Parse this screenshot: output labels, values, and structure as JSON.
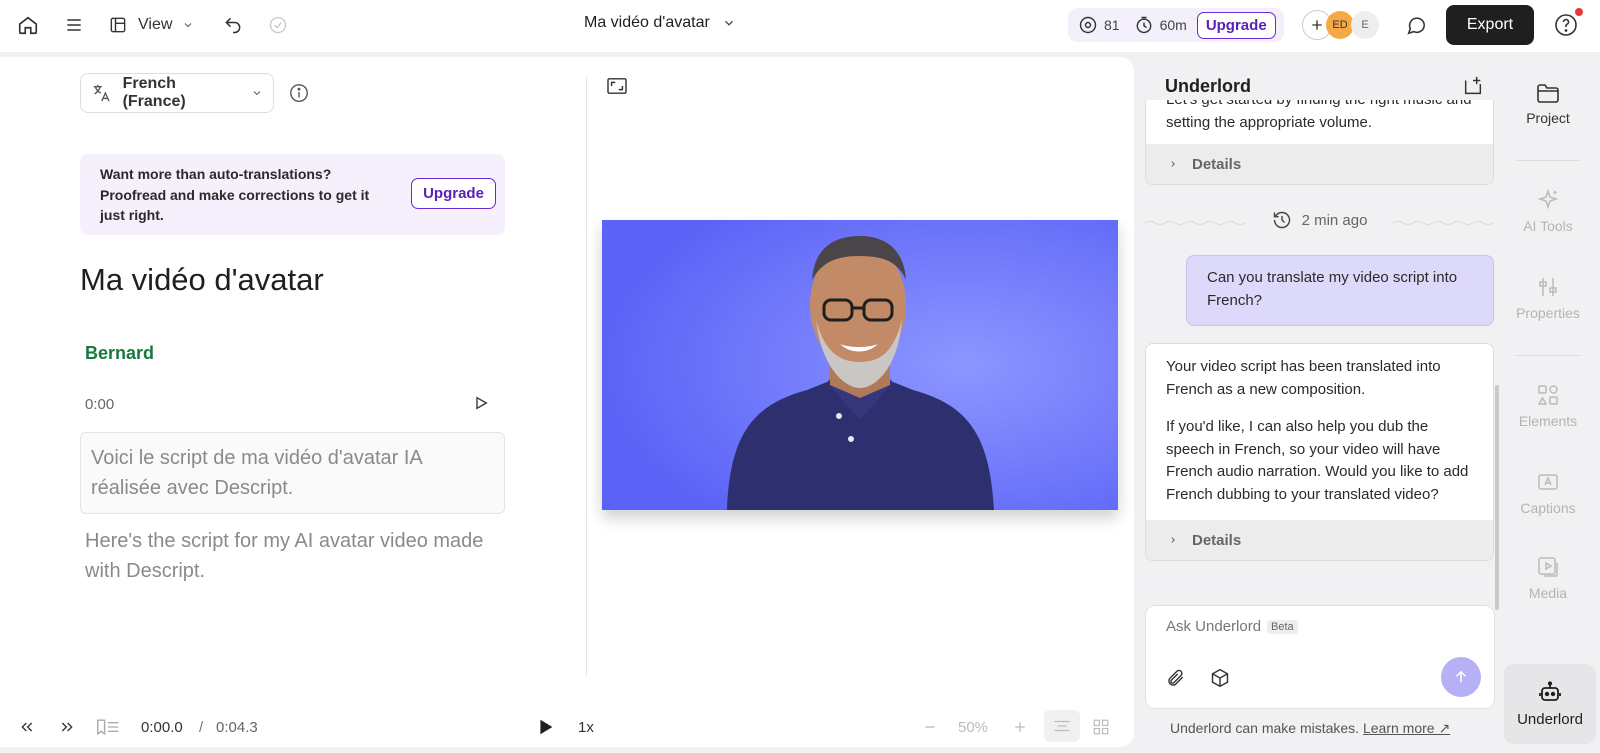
{
  "topbar": {
    "view_label": "View",
    "project_title": "Ma vidéo d'avatar",
    "media_count": "81",
    "time_remaining": "60m",
    "upgrade_label": "Upgrade",
    "avatar_1": "ED",
    "avatar_2": "E",
    "export_label": "Export"
  },
  "editor": {
    "language": "French (France)",
    "banner_text": "Want more than auto-translations? Proofread and make corrections to get it just right.",
    "banner_button": "Upgrade",
    "doc_title": "Ma vidéo d'avatar",
    "speaker": "Bernard",
    "timecode": "0:00",
    "translated_script": "Voici le script de ma vidéo d'avatar IA réalisée avec Descript.",
    "original_script": "Here's the script for my AI avatar video made with Descript."
  },
  "playback": {
    "current_time": "0:00.0",
    "separator": "/",
    "duration": "0:04.3",
    "speed": "1x",
    "zoom": "50%"
  },
  "underlord": {
    "title": "Underlord",
    "prev_message": "Let's get started by finding the right music and setting the appropriate volume.",
    "details_label": "Details",
    "timestamp": "2 min ago",
    "user_message": "Can you translate my video script into French?",
    "reply_p1": "Your video script has been translated into French as a new composition.",
    "reply_p2": "If you'd like, I can also help you dub the speech in French, so your video will have French audio narration. Would you like to add French dubbing to your translated video?",
    "ask_placeholder": "Ask Underlord",
    "beta_label": "Beta",
    "disclaimer": "Underlord can make mistakes.",
    "learn_more": "Learn more ↗"
  },
  "rail": {
    "project": "Project",
    "ai_tools": "AI Tools",
    "properties": "Properties",
    "elements": "Elements",
    "captions": "Captions",
    "media": "Media",
    "underlord": "Underlord"
  },
  "colors": {
    "accent": "#6d28d9",
    "speaker": "#167a3e",
    "video_bg": "#6169ff",
    "user_bubble": "#ddd9fb"
  }
}
